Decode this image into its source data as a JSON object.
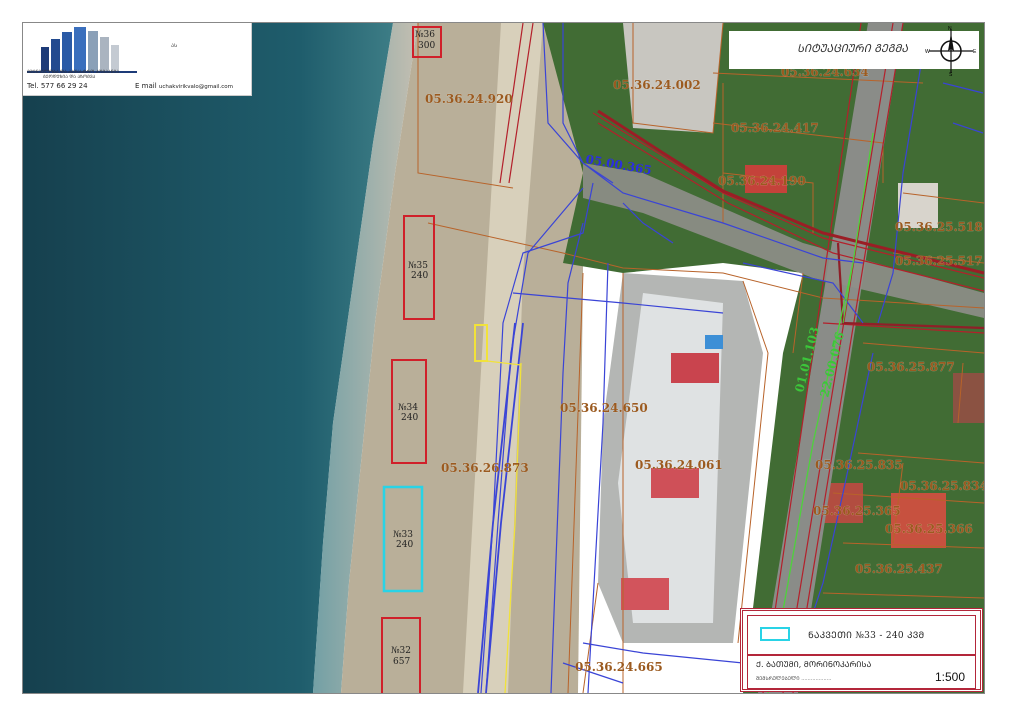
{
  "logo": {
    "company_line1": "ᲛᲨᲔᲜᲔᲑᲚᲝᲑᲐ ᲓᲐ ᲙᲐᲓᲐᲡᲢᲠᲝ ᲙᲝᲛᲞᲐᲜᲘᲐ",
    "company_line2": "ᲒᲔᲝᲓᲔᲖᲘᲐ ᲓᲐ ᲐᲖᲝᲛᲕᲐ",
    "mini_text": "ᲐᲡ",
    "tel_label": "Tel.",
    "tel_value": "577 66 29 24",
    "mail_label": "E mail",
    "mail_value": "uchakvirikvalo@gmail.com"
  },
  "north_panel": {
    "script_text": "ᲡᲘᲢᲣᲐᲪᲘᲣᲠᲘ ᲒᲔᲒᲛᲐ",
    "compass": {
      "n": "N",
      "e": "E",
      "s": "S",
      "w": "W"
    }
  },
  "legend": {
    "plot_text": "ᲜᲐᲙᲕᲔᲗᲘ  №33  -  240  ᲙᲕᲛ",
    "location_text": "Ქ. ᲑᲐᲗᲣᲛᲘ, ᲛᲝᲠᲘᲜᲝᲙᲐᲠᲘᲡᲐ",
    "made_by": "ᲨᲔᲛᲡᲠᲣᲚᲔᲑᲔᲚᲘ  ...................",
    "scale": "1:500",
    "swatch_color": "#29d3e6"
  },
  "plots": [
    {
      "number": "№36",
      "area": "300"
    },
    {
      "number": "№35",
      "area": "240"
    },
    {
      "number": "№34",
      "area": "240"
    },
    {
      "number": "№33",
      "area": "240"
    },
    {
      "number": "№32",
      "area": "657"
    }
  ],
  "road_labels": {
    "road_05_00_365": "05.00.365",
    "road_01_01_103": "01.01.103",
    "road_22_00_076": "22.00.076"
  },
  "parcels": {
    "p_05_36_24_920": "05.36.24.920",
    "p_05_36_24_002": "05.36.24.002",
    "p_05_36_24_634": "05.36.24.634",
    "p_05_36_24_417": "05.36.24.417",
    "p_05_36_24_190": "05.36.24.190",
    "p_05_36_25_518": "05.36.25.518",
    "p_05_36_25_517": "05.36.25.517",
    "p_05_36_25_877": "05.36.25.877",
    "p_05_36_24_650": "05.36.24.650",
    "p_05_36_26_873": "05.36.26.873",
    "p_05_36_24_061": "05.36.24.061",
    "p_05_36_25_835": "05.36.25.835",
    "p_05_36_25_834": "05.36.25.834",
    "p_05_36_25_365": "05.36.25.365",
    "p_05_36_25_366": "05.36.25.366",
    "p_05_36_25_437": "05.36.25.437",
    "p_05_36_24_665": "05.36.24.665"
  },
  "colors": {
    "sea": "#1f5a6a",
    "beach": "#b7ad97",
    "vegetation": "#3f6b33",
    "parcel_line": "#b8632a",
    "plot_red": "#d0202a",
    "plot_cyan": "#29d3e6",
    "network_blue": "#3a44d6",
    "road_red": "#9b1d25",
    "green_line": "#4ed23c",
    "yellow_line": "#f1e23a"
  }
}
